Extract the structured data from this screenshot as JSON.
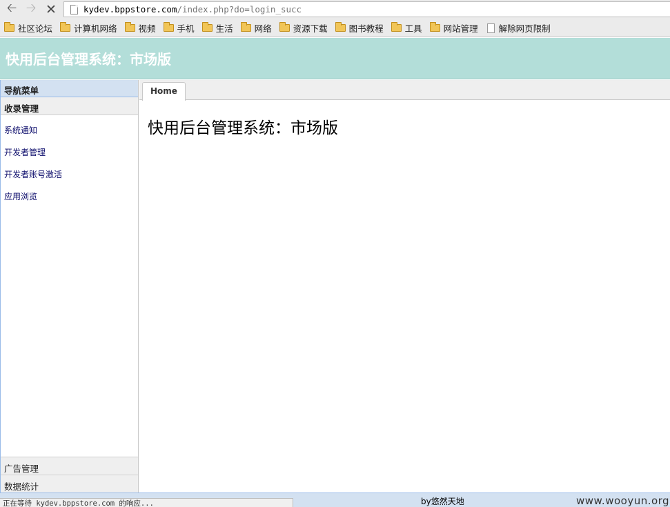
{
  "browser": {
    "url_host": "kydev.bppstore.com",
    "url_path": "/index.php?do=login_succ",
    "bookmarks": [
      {
        "label": "社区论坛",
        "type": "folder"
      },
      {
        "label": "计算机网络",
        "type": "folder"
      },
      {
        "label": "视频",
        "type": "folder"
      },
      {
        "label": "手机",
        "type": "folder"
      },
      {
        "label": "生活",
        "type": "folder"
      },
      {
        "label": "网络",
        "type": "folder"
      },
      {
        "label": "资源下载",
        "type": "folder"
      },
      {
        "label": "图书教程",
        "type": "folder"
      },
      {
        "label": "工具",
        "type": "folder"
      },
      {
        "label": "网站管理",
        "type": "folder"
      },
      {
        "label": "解除网页限制",
        "type": "page"
      }
    ],
    "status_text": "正在等待 kydev.bppstore.com 的响应..."
  },
  "app": {
    "title": "快用后台管理系统：市场版"
  },
  "sidebar": {
    "header": "导航菜单",
    "section": "收录管理",
    "items": [
      {
        "label": "系统通知"
      },
      {
        "label": "开发者管理"
      },
      {
        "label": "开发者账号激活"
      },
      {
        "label": "应用浏览"
      }
    ],
    "bottom_sections": [
      {
        "label": "广告管理"
      },
      {
        "label": "数据统计"
      }
    ]
  },
  "main": {
    "tab_label": "Home",
    "content_title": "快用后台管理系统：市场版"
  },
  "footer": {
    "credit": "by悠然天地",
    "watermark": "www.wooyun.org"
  }
}
